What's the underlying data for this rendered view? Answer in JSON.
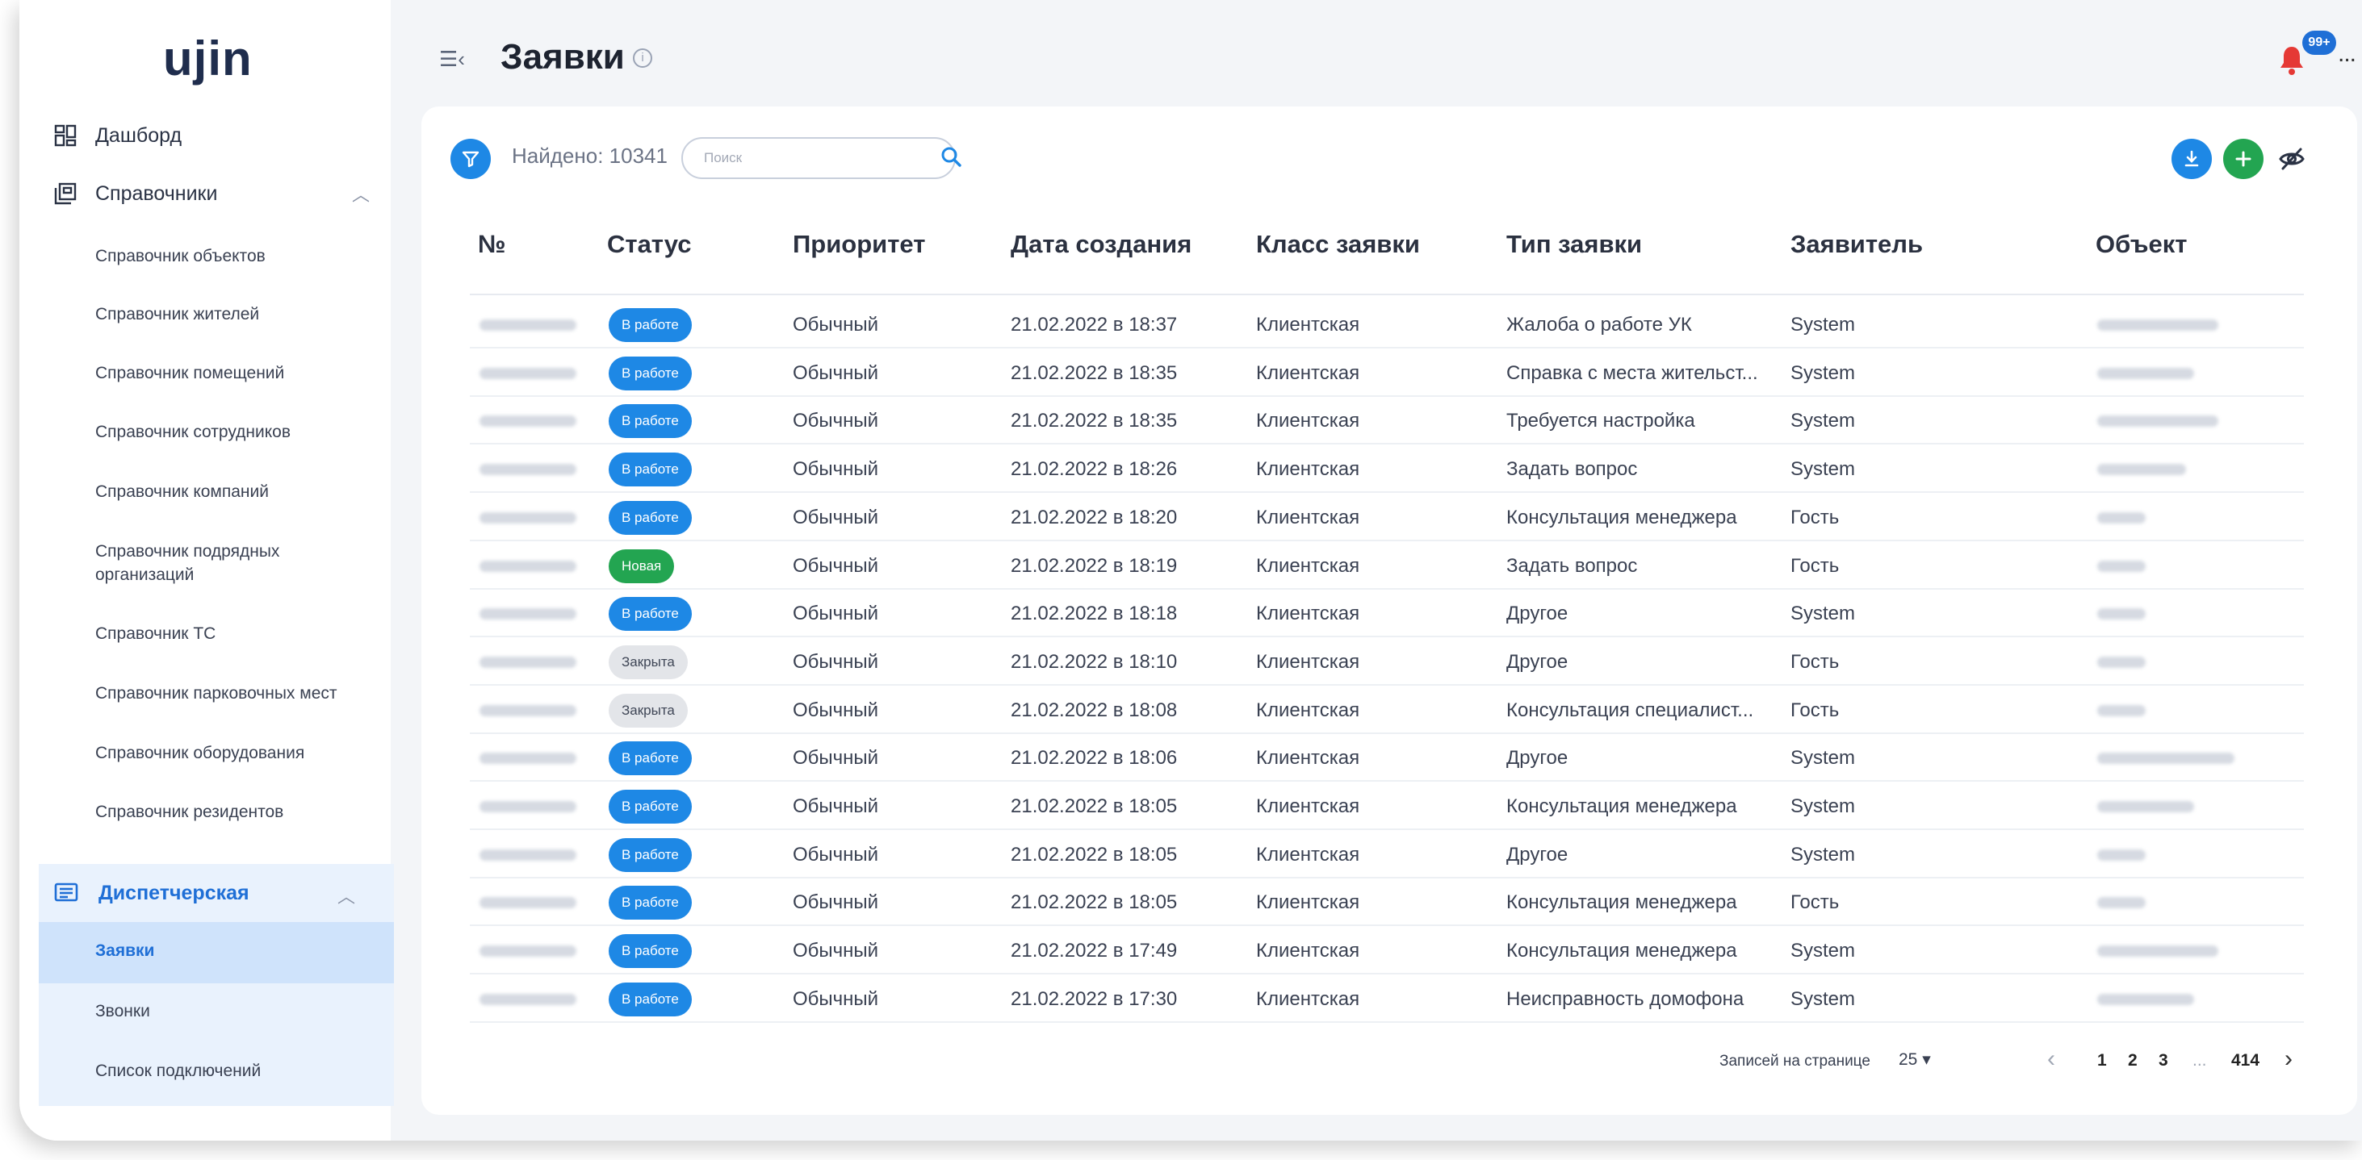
{
  "app": {
    "logo": "ujin"
  },
  "sidebar": {
    "dashboard": "Дашборд",
    "directories": "Справочники",
    "directory_items": [
      "Справочник объектов",
      "Справочник жителей",
      "Справочник помещений",
      "Справочник сотрудников",
      "Справочник компаний",
      "Справочник подрядных",
      "организаций",
      "Справочник ТС",
      "Справочник парковочных мест",
      "Справочник оборудования",
      "Справочник резидентов"
    ],
    "dispatch": "Диспетчерская",
    "dispatch_items": [
      "Заявки",
      "Звонки",
      "Список подключений"
    ]
  },
  "header": {
    "title": "Заявки",
    "info": "i",
    "notifications_badge": "99+",
    "more": "..."
  },
  "toolbar": {
    "found_label": "Найдено: 10341",
    "search_placeholder": "Поиск"
  },
  "table": {
    "columns": [
      "№",
      "Статус",
      "Приоритет",
      "Дата создания",
      "Класс заявки",
      "Тип заявки",
      "Заявитель",
      "Объект"
    ],
    "rows": [
      {
        "status": "В работе",
        "kind": "work",
        "priority": "Обычный",
        "date": "21.02.2022 в 18:37",
        "class": "Клиентская",
        "type": "Жалоба о работе УК",
        "applicant": "System"
      },
      {
        "status": "В работе",
        "kind": "work",
        "priority": "Обычный",
        "date": "21.02.2022 в 18:35",
        "class": "Клиентская",
        "type": "Справка с места жительст...",
        "applicant": "System"
      },
      {
        "status": "В работе",
        "kind": "work",
        "priority": "Обычный",
        "date": "21.02.2022 в 18:35",
        "class": "Клиентская",
        "type": "Требуется настройка",
        "applicant": "System"
      },
      {
        "status": "В работе",
        "kind": "work",
        "priority": "Обычный",
        "date": "21.02.2022 в 18:26",
        "class": "Клиентская",
        "type": "Задать вопрос",
        "applicant": "System"
      },
      {
        "status": "В работе",
        "kind": "work",
        "priority": "Обычный",
        "date": "21.02.2022 в 18:20",
        "class": "Клиентская",
        "type": "Консультация менеджера",
        "applicant": "Гость"
      },
      {
        "status": "Новая",
        "kind": "new",
        "priority": "Обычный",
        "date": "21.02.2022 в 18:19",
        "class": "Клиентская",
        "type": "Задать вопрос",
        "applicant": "Гость"
      },
      {
        "status": "В работе",
        "kind": "work",
        "priority": "Обычный",
        "date": "21.02.2022 в 18:18",
        "class": "Клиентская",
        "type": "Другое",
        "applicant": "System"
      },
      {
        "status": "Закрыта",
        "kind": "closed",
        "priority": "Обычный",
        "date": "21.02.2022 в 18:10",
        "class": "Клиентская",
        "type": "Другое",
        "applicant": "Гость"
      },
      {
        "status": "Закрыта",
        "kind": "closed",
        "priority": "Обычный",
        "date": "21.02.2022 в 18:08",
        "class": "Клиентская",
        "type": "Консультация специалист...",
        "applicant": "Гость"
      },
      {
        "status": "В работе",
        "kind": "work",
        "priority": "Обычный",
        "date": "21.02.2022 в 18:06",
        "class": "Клиентская",
        "type": "Другое",
        "applicant": "System"
      },
      {
        "status": "В работе",
        "kind": "work",
        "priority": "Обычный",
        "date": "21.02.2022 в 18:05",
        "class": "Клиентская",
        "type": "Консультация менеджера",
        "applicant": "System"
      },
      {
        "status": "В работе",
        "kind": "work",
        "priority": "Обычный",
        "date": "21.02.2022 в 18:05",
        "class": "Клиентская",
        "type": "Другое",
        "applicant": "System"
      },
      {
        "status": "В работе",
        "kind": "work",
        "priority": "Обычный",
        "date": "21.02.2022 в 18:05",
        "class": "Клиентская",
        "type": "Консультация менеджера",
        "applicant": "Гость"
      },
      {
        "status": "В работе",
        "kind": "work",
        "priority": "Обычный",
        "date": "21.02.2022 в 17:49",
        "class": "Клиентская",
        "type": "Консультация менеджера",
        "applicant": "System"
      },
      {
        "status": "В работе",
        "kind": "work",
        "priority": "Обычный",
        "date": "21.02.2022 в 17:30",
        "class": "Клиентская",
        "type": "Неисправность домофона",
        "applicant": "System"
      }
    ]
  },
  "pagination": {
    "per_page_label": "Записей на странице",
    "per_page": "25 ▾",
    "pages": [
      "1",
      "2",
      "3",
      "...",
      "414"
    ],
    "prev": "‹",
    "next": "›"
  },
  "colors": {
    "accent": "#1e88e5",
    "success": "#23a551",
    "closed": "#e3e5e9"
  }
}
